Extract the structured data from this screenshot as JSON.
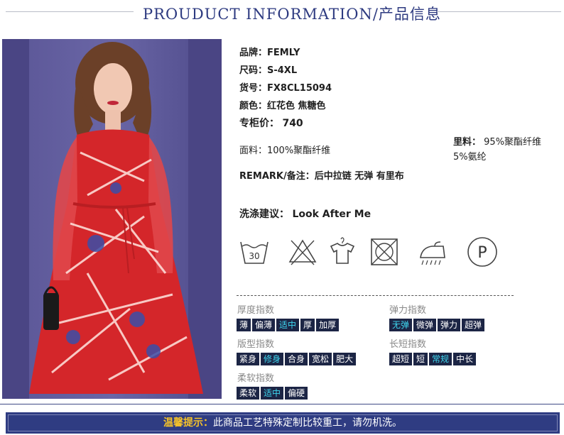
{
  "header": {
    "title": "PROUDUCT INFORMATION/产品信息"
  },
  "product": {
    "brand": "品牌：FEMLY",
    "size": "尺码：S-4XL",
    "item_no": "货号：FX8CL15094",
    "color": "颜色：红花色 焦糖色",
    "price_label": "专柜价：",
    "price_value": "740",
    "fabric": "面料：100%聚酯纤维",
    "lining_label": "里料：",
    "lining_line1": "95%聚酯纤维",
    "lining_line2": "5%氨纶",
    "remark": "REMARK/备注：后中拉链 无弹 有里布",
    "wash_label": "洗涤建议：",
    "wash_value": "Look After Me"
  },
  "care_icons": [
    "wash-30-icon",
    "do-not-bleach-icon",
    "hang-dry-icon",
    "do-not-tumble-dry-icon",
    "iron-steam-icon",
    "dry-clean-p-icon"
  ],
  "care_wash_temp": "30",
  "care_dryclean_letter": "P",
  "indices": {
    "thickness": {
      "label": "厚度指数",
      "options": [
        "薄",
        "偏薄",
        "适中",
        "厚",
        "加厚"
      ],
      "selected": "适中"
    },
    "elasticity": {
      "label": "弹力指数",
      "options": [
        "无弹",
        "微弹",
        "弹力",
        "超弹"
      ],
      "selected": "无弹"
    },
    "fit": {
      "label": "版型指数",
      "options": [
        "紧身",
        "修身",
        "合身",
        "宽松",
        "肥大"
      ],
      "selected": "修身"
    },
    "length": {
      "label": "长短指数",
      "options": [
        "超短",
        "短",
        "常规",
        "中长"
      ],
      "selected": "常规"
    },
    "softness": {
      "label": "柔软指数",
      "options": [
        "柔软",
        "适中",
        "偏硬"
      ],
      "selected": "适中"
    }
  },
  "footer": {
    "label": "温馨提示：",
    "text": "此商品工艺特殊定制比较重工，请勿机洗。"
  },
  "colors": {
    "navy": "#2f3c82",
    "tag_bg": "#1c2545",
    "tag_selected": "#3fd7f0",
    "dress_red": "#d4262a",
    "backdrop": "#5d5898"
  }
}
